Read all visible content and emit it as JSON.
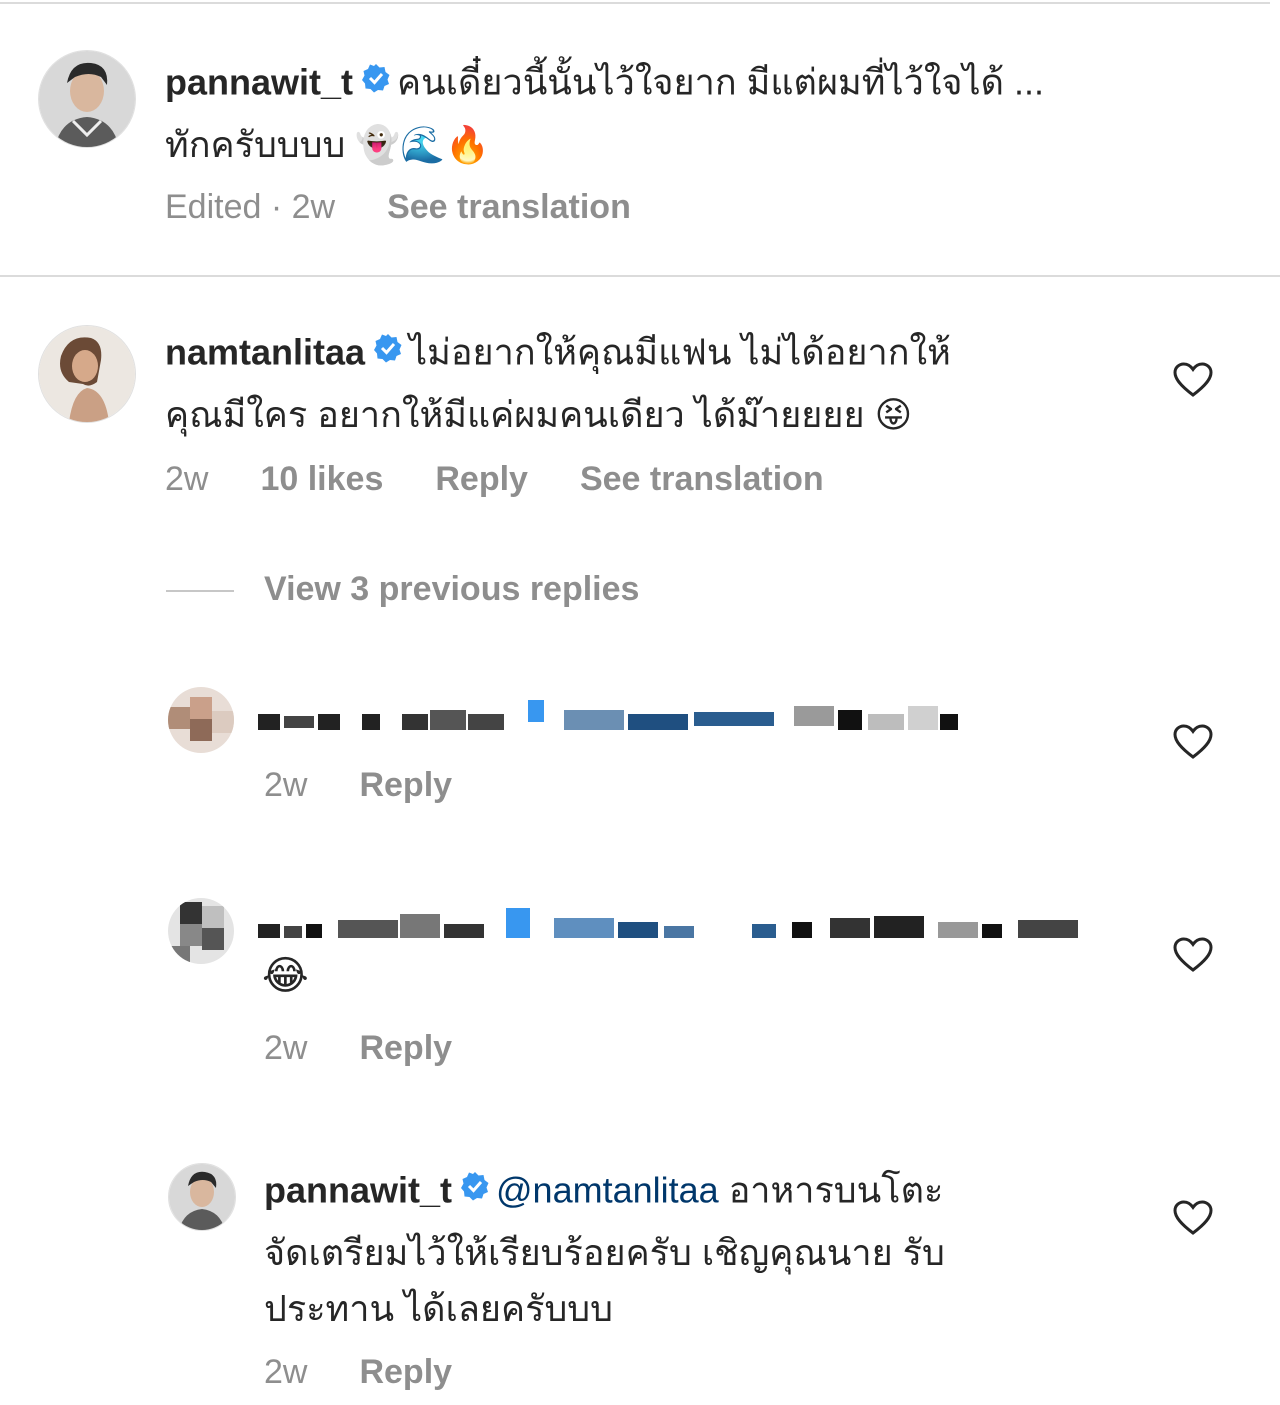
{
  "colors": {
    "text": "#262626",
    "meta": "#8e8e8e",
    "verified": "#3897f0",
    "mention": "#00376b",
    "divider": "#dbdbdb"
  },
  "comments": [
    {
      "username": "pannawit_t",
      "text_line1": "คนเดี๋ยวนี้นั้นไว้ใจยาก มีแต่ผมที่ไว้ใจได้ ...",
      "text_line2": "ทักครับบบบ 👻🌊🔥",
      "meta_time": "Edited · 2w",
      "see_translation": "See translation"
    },
    {
      "username": "namtanlitaa",
      "text_line1": "ไม่อยากให้คุณมีแฟน ไม่ได้อยากให้",
      "text_line2": "คุณมีใคร อยากให้มีแค่ผมคนเดียว ได้ม๊ายยยย 😝",
      "time": "2w",
      "likes": "10 likes",
      "reply": "Reply",
      "see_translation": "See translation"
    }
  ],
  "view_previous": "View 3 previous replies",
  "replies": [
    {
      "time": "2w",
      "reply": "Reply"
    },
    {
      "emoji": "😂",
      "time": "2w",
      "reply": "Reply"
    },
    {
      "username": "pannawit_t",
      "mention": "@namtanlitaa",
      "text_line1_rest": " อาหารบนโตะ",
      "text_line2": "จัดเตรียมไว้ให้เรียบร้อยครับ เชิญคุณนาย รับ",
      "text_line3": "ประทาน ได้เลยครับบบ",
      "time": "2w",
      "reply": "Reply"
    }
  ],
  "icons": [
    "verified-badge-icon",
    "heart-icon"
  ]
}
